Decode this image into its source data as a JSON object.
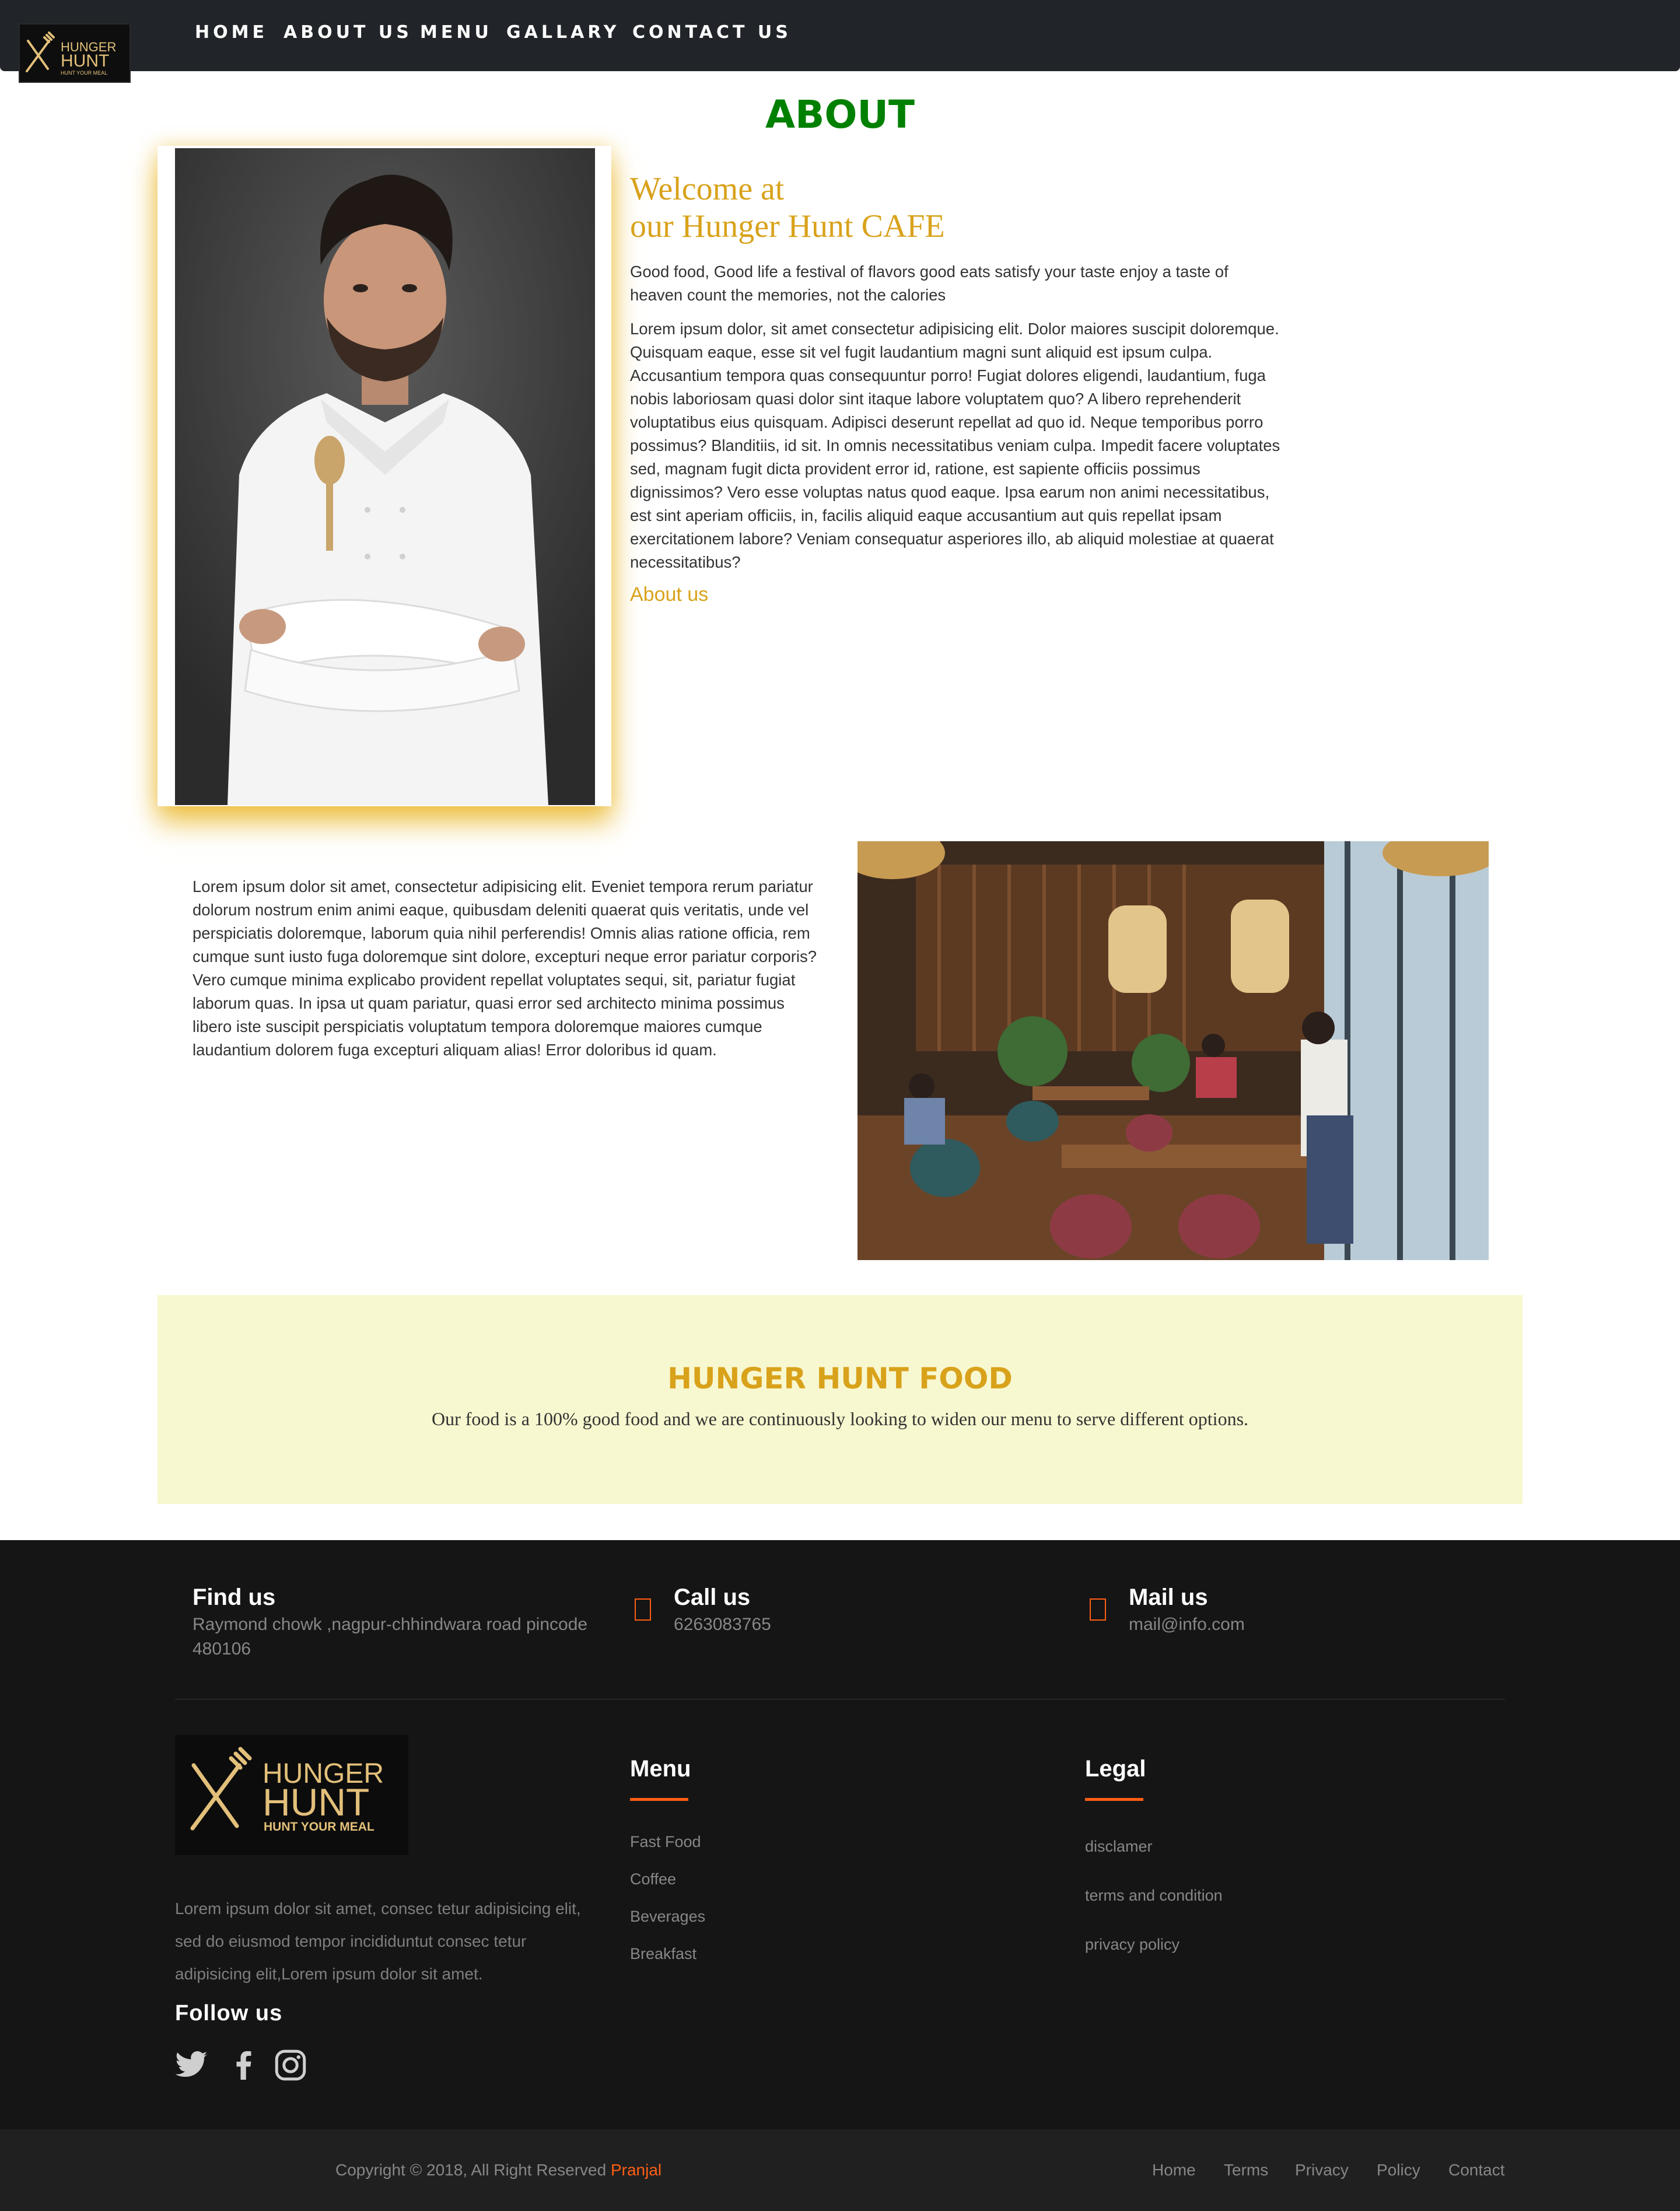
{
  "nav": {
    "links": [
      "HOME",
      "ABOUT US",
      "MENU",
      "GALLARY",
      "CONTACT US"
    ]
  },
  "brand": {
    "line1": "HUNGER",
    "line2": "HUNT",
    "tagline": "HUNT YOUR MEAL"
  },
  "about": {
    "title": "ABOUT",
    "welcome_line1": "Welcome at",
    "welcome_line2": "our Hunger Hunt CAFE",
    "tagline": "Good food, Good life a festival of flavors good eats satisfy your taste enjoy a taste of heaven count the memories, not the calories",
    "paragraph": "Lorem ipsum dolor, sit amet consectetur adipisicing elit. Dolor maiores suscipit doloremque. Quisquam eaque, esse sit vel fugit laudantium magni sunt aliquid est ipsum culpa. Accusantium tempora quas consequuntur porro! Fugiat dolores eligendi, laudantium, fuga nobis laboriosam quasi dolor sint itaque labore voluptatem quo? A libero reprehenderit voluptatibus eius quisquam. Adipisci deserunt repellat ad quo id. Neque temporibus porro possimus? Blanditiis, id sit. In omnis necessitatibus veniam culpa. Impedit facere voluptates sed, magnam fugit dicta provident error id, ratione, est sapiente officiis possimus dignissimos? Vero esse voluptas natus quod eaque. Ipsa earum non animi necessitatibus, est sint aperiam officiis, in, facilis aliquid eaque accusantium aut quis repellat ipsam exercitationem labore? Veniam consequatur asperiores illo, ab aliquid molestiae at quaerat necessitatibus?",
    "link": "About us"
  },
  "second": {
    "paragraph": "Lorem ipsum dolor sit amet, consectetur adipisicing elit. Eveniet tempora rerum pariatur dolorum nostrum enim animi eaque, quibusdam deleniti quaerat quis veritatis, unde vel perspiciatis doloremque, laborum quia nihil perferendis! Omnis alias ratione officia, rem cumque sunt iusto fuga doloremque sint dolore, excepturi neque error pariatur corporis? Vero cumque minima explicabo provident repellat voluptates sequi, sit, pariatur fugiat laborum quas. In ipsa ut quam pariatur, quasi error sed architecto minima possimus libero iste suscipit perspiciatis voluptatum tempora doloremque maiores cumque laudantium dolorem fuga excepturi aliquam alias! Error doloribus id quam."
  },
  "food": {
    "title": "HUNGER HUNT FOOD",
    "description": "Our food is a 100% good food and we are continuously looking to widen our menu to serve different options."
  },
  "footer": {
    "find": {
      "title": "Find us",
      "text": "Raymond chowk ,nagpur-chhindwara road pincode 480106"
    },
    "call": {
      "title": "Call us",
      "text": "6263083765"
    },
    "mail": {
      "title": "Mail us",
      "text": "mail@info.com"
    },
    "description": "Lorem ipsum dolor sit amet, consec tetur adipisicing elit, sed do eiusmod tempor incididuntut consec tetur adipisicing elit,Lorem ipsum dolor sit amet.",
    "follow": "Follow us",
    "menu": {
      "title": "Menu",
      "items": [
        "Fast Food",
        "Coffee",
        "Beverages",
        "Breakfast"
      ]
    },
    "legal": {
      "title": "Legal",
      "items": [
        "disclamer",
        "terms and condition",
        "privacy policy"
      ]
    },
    "copyright": "Copyright © 2018, All Right Reserved ",
    "author": "Pranjal",
    "bottom_links": [
      "Home",
      "Terms",
      "Privacy",
      "Policy",
      "Contact"
    ]
  },
  "colors": {
    "accent_gold": "#d9a21b",
    "about_green": "#008000",
    "footer_orange": "#ff5e14",
    "nav_bg": "#212428",
    "footer_bg": "#151515"
  },
  "icons": [
    "logo-fork-knife-icon",
    "map-marker-icon",
    "phone-icon",
    "envelope-icon",
    "twitter-icon",
    "facebook-icon",
    "instagram-icon"
  ]
}
